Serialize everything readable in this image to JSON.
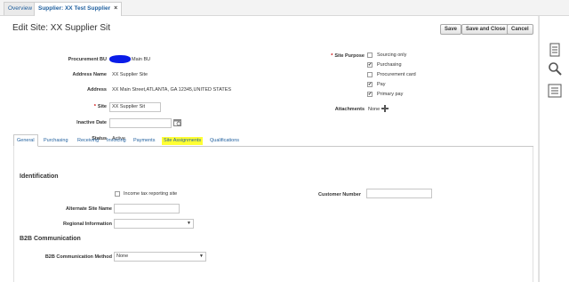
{
  "tabs": [
    {
      "label": "Overview"
    },
    {
      "label": "Supplier: XX Test Supplier",
      "close": "×"
    }
  ],
  "page": {
    "title": "Edit Site: XX Supplier Sit",
    "buttons": {
      "save": "Save",
      "save_close": "Save and Close",
      "cancel": "Cancel"
    }
  },
  "form": {
    "procurement_bu": {
      "label": "Procurement BU",
      "value": "Main BU"
    },
    "address_name": {
      "label": "Address Name",
      "value": "XX Supplier Site"
    },
    "address": {
      "label": "Address",
      "value": "XX Main Street,ATLANTA, GA 12345,UNITED STATES"
    },
    "site": {
      "required": "*",
      "label": "Site",
      "value": "XX Supplier Sit"
    },
    "inactive_date": {
      "label": "Inactive Date",
      "value": ""
    },
    "status": {
      "label": "Status",
      "value": "Active"
    },
    "site_purpose": {
      "required": "*",
      "label": "Site Purpose",
      "options": [
        {
          "label": "Sourcing only",
          "checked": false
        },
        {
          "label": "Purchasing",
          "checked": true
        },
        {
          "label": "Procurement card",
          "checked": false
        },
        {
          "label": "Pay",
          "checked": true
        },
        {
          "label": "Primary pay",
          "checked": true
        }
      ]
    },
    "attachments": {
      "label": "Attachments",
      "value": "None"
    }
  },
  "subtabs": [
    {
      "label": "General",
      "active": true
    },
    {
      "label": "Purchasing"
    },
    {
      "label": "Receiving"
    },
    {
      "label": "Invoicing"
    },
    {
      "label": "Payments"
    },
    {
      "label": "Site Assignments",
      "highlighted": true
    },
    {
      "label": "Qualifications"
    }
  ],
  "general": {
    "identification": {
      "heading": "Identification",
      "income_tax": {
        "label": "Income tax reporting site",
        "checked": false
      },
      "customer_number": {
        "label": "Customer Number",
        "value": ""
      },
      "alternate_site_name": {
        "label": "Alternate Site Name",
        "value": ""
      },
      "regional_information": {
        "label": "Regional Information",
        "value": ""
      }
    },
    "b2b": {
      "heading": "B2B Communication",
      "method": {
        "label": "B2B Communication Method",
        "value": "None"
      }
    }
  },
  "check_mark": "✔",
  "dropdown_arrow": "▼",
  "calendar_icon": "calendar-icon",
  "accent_color": "#1f5f9e",
  "highlight_color": "#ffff33"
}
